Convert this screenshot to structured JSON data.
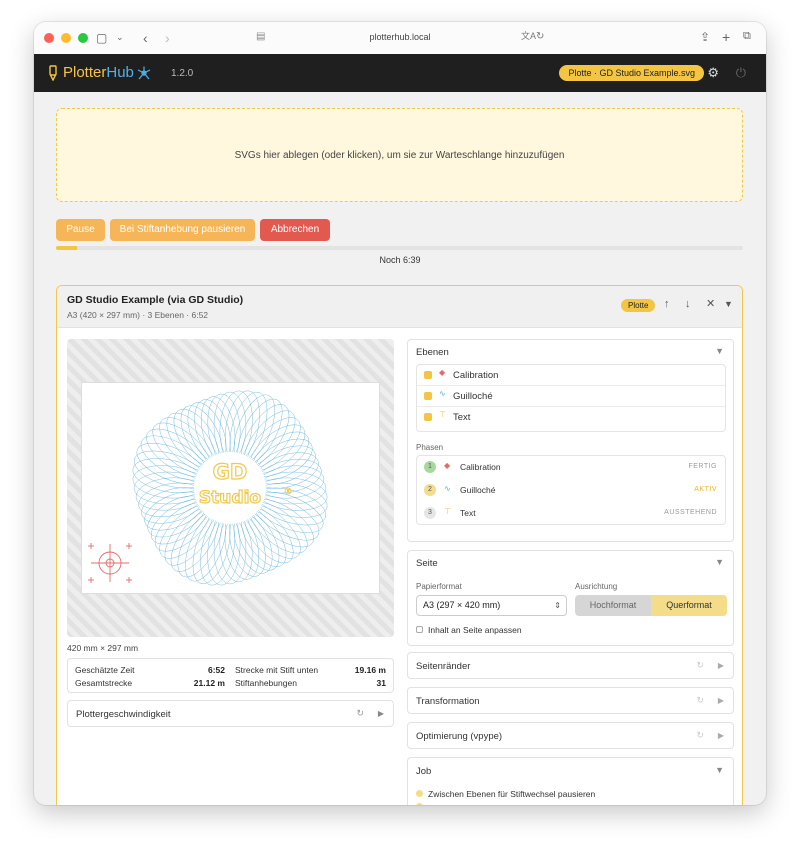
{
  "browser": {
    "url": "plotterhub.local"
  },
  "app": {
    "name_plotter": "Plotter",
    "name_hub": "Hub",
    "version": "1.2.0",
    "status_pill": "Plotte · GD Studio Example.svg"
  },
  "dropzone": {
    "text": "SVGs hier ablegen (oder klicken), um sie zur Warteschlange hinzuzufügen"
  },
  "controls": {
    "pause": "Pause",
    "pause_on_lift": "Bei Stiftanhebung pausieren",
    "cancel": "Abbrechen",
    "progress": 0.03,
    "remaining": "Noch 6:39"
  },
  "job": {
    "title": "GD Studio Example (via GD Studio)",
    "subtitle": "A3 (420 × 297 mm) · 3 Ebenen · 6:52",
    "badge": "Plotte",
    "preview_logo_line1": "GD",
    "preview_logo_line2": "Studio",
    "dims": "420 mm × 297 mm",
    "stats": {
      "est_time_label": "Geschätzte Zeit",
      "est_time_value": "6:52",
      "total_label": "Gesamtstrecke",
      "total_value": "21.12 m",
      "pen_down_label": "Strecke mit Stift unten",
      "pen_down_value": "19.16 m",
      "lifts_label": "Stiftanhebungen",
      "lifts_value": "31"
    },
    "speed_label": "Plottergeschwindigkeit"
  },
  "layers": {
    "title": "Ebenen",
    "items": [
      {
        "name": "Calibration",
        "color": "#e76a6a"
      },
      {
        "name": "Guilloché",
        "color": "#5aaedc"
      },
      {
        "name": "Text",
        "color": "#f2c84b"
      }
    ],
    "phases_label": "Phasen",
    "phases": [
      {
        "num": "1",
        "name": "Calibration",
        "status": "FERTIG",
        "status_color": "#9a9a9a",
        "num_bg": "#a8d8a0"
      },
      {
        "num": "2",
        "name": "Guilloché",
        "status": "AKTIV",
        "status_color": "#e8b32a",
        "num_bg": "#f4dc8a"
      },
      {
        "num": "3",
        "name": "Text",
        "status": "AUSSTEHEND",
        "status_color": "#9a9a9a",
        "num_bg": "#e6e6e6"
      }
    ]
  },
  "page": {
    "title": "Seite",
    "paper_label": "Papierformat",
    "paper_value": "A3 (297 × 420 mm)",
    "orientation_label": "Ausrichtung",
    "portrait": "Hochformat",
    "landscape": "Querformat",
    "fit_label": "Inhalt an Seite anpassen"
  },
  "sections": {
    "margins": "Seitenränder",
    "transform": "Transformation",
    "optimize": "Optimierung (vpype)",
    "job": "Job",
    "job_option_1": "Zwischen Ebenen für Stiftwechsel pausieren"
  },
  "colors": {
    "accent": "#f4c542",
    "orange": "#f6b657",
    "danger": "#e25a4f",
    "blue": "#5aaedc"
  }
}
